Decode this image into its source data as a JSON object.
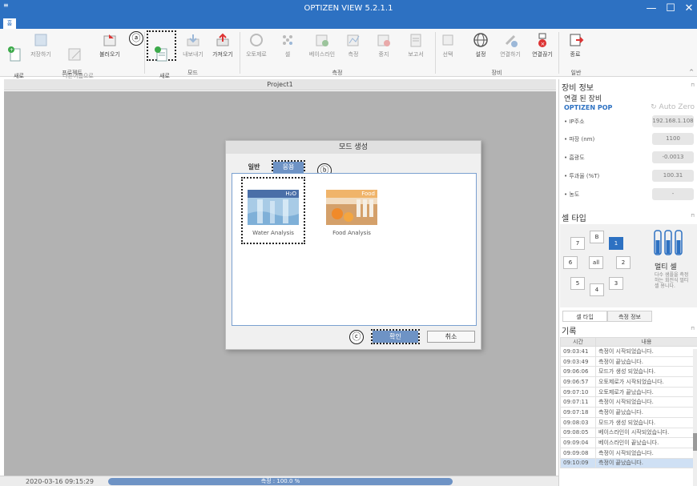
{
  "window": {
    "title": "OPTIZEN VIEW 5.2.1.1",
    "home_tab": "홈"
  },
  "ribbon": {
    "buttons": {
      "new_project": "새로\n만들기",
      "save": "저장하기",
      "save_as": "다른이름으로\n저장하기",
      "open": "불러오기",
      "new_mode": "새로\n만들기",
      "export": "내보내기",
      "import": "가져오기",
      "auto_zero": "오토제로",
      "cell": "셀",
      "baseline": "베이스라인",
      "measure": "측정",
      "stop": "중지",
      "report": "보고서",
      "select": "선택",
      "settings": "설정",
      "connect": "연결하기",
      "disconnect": "연결끊기",
      "exit": "종료"
    },
    "groups": {
      "project": "프로젝트",
      "mode": "모드",
      "measure": "측정",
      "device": "장비",
      "general": "일반"
    }
  },
  "markers": {
    "a": "ⓐ",
    "b": "ⓑ",
    "c": "ⓒ"
  },
  "document": {
    "title": "Project1"
  },
  "status": {
    "datetime": "2020-03-16 09:15:29",
    "progress_label": "측정 : 100.0 %",
    "progress": 1.0
  },
  "dialog": {
    "title": "모드 생성",
    "tab_general": "일반",
    "tab_applied": "응용",
    "tiles": [
      {
        "banner": "H₂O",
        "label": "Water Analysis",
        "banner_color": "#4a6fa8"
      },
      {
        "banner": "Food",
        "label": "Food Analysis",
        "banner_color": "#f0b46a"
      }
    ],
    "ok": "확인",
    "cancel": "취소"
  },
  "device_panel": {
    "title": "장비 정보",
    "connected": "연결 된 장비",
    "device_name": "OPTIZEN POP",
    "auto_zero": "Auto Zero",
    "props": [
      {
        "label": "• IP주소",
        "value": "192.168.1.108"
      },
      {
        "label": "• 파장 (nm)",
        "value": "1100"
      },
      {
        "label": "• 흡광도",
        "value": "-0.0013"
      },
      {
        "label": "• 투과율 (%T)",
        "value": "100.31"
      },
      {
        "label": "• 농도",
        "value": "-"
      }
    ]
  },
  "cell_panel": {
    "title": "셀 타입",
    "buttons": [
      "7",
      "B",
      "1",
      "6",
      "all",
      "2",
      "5",
      "4",
      "3"
    ],
    "active": "1",
    "name": "멀티 셀",
    "description": "다수 샘플을 측정하는 회전식 멀티 셀 용니다.",
    "tabs": [
      "셀 타입",
      "측정 정보"
    ]
  },
  "log_panel": {
    "title": "기록",
    "columns": [
      "시간",
      "내용"
    ],
    "rows": [
      [
        "09:03:41",
        "측정이 시작되었습니다."
      ],
      [
        "09:03:49",
        "측정이 끝났습니다."
      ],
      [
        "09:06:06",
        "모드가 생성 되었습니다."
      ],
      [
        "09:06:57",
        "오토제로가 시작되었습니다."
      ],
      [
        "09:07:10",
        "오토제로가 끝났습니다."
      ],
      [
        "09:07:11",
        "측정이 시작되었습니다."
      ],
      [
        "09:07:18",
        "측정이 끝났습니다."
      ],
      [
        "09:08:03",
        "모드가 생성 되었습니다."
      ],
      [
        "09:08:05",
        "베이스라인이 시작되었습니다."
      ],
      [
        "09:09:04",
        "베이스라인이 끝났습니다."
      ],
      [
        "09:09:08",
        "측정이 시작되었습니다."
      ],
      [
        "09:10:09",
        "측정이 끝났습니다."
      ]
    ]
  }
}
